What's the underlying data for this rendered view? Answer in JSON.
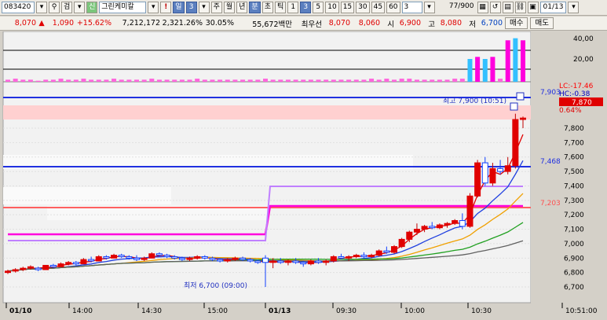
{
  "toolbar": {
    "stock_code": "083420",
    "search_label": "검",
    "stock_name": "그린케미칼",
    "alert_label": "!",
    "period_label": "일",
    "period_value": "3",
    "periods": [
      "주",
      "월",
      "년",
      "분",
      "초",
      "틱"
    ],
    "minute_options": [
      "1",
      "3",
      "5",
      "10",
      "15",
      "30",
      "45",
      "60"
    ],
    "selected_minute": "3",
    "count_value": "3",
    "data_count": "77/900",
    "date": "01/13"
  },
  "quote": {
    "price": "8,070",
    "change": "1,090",
    "change_rate": "+15.62%",
    "volume": "7,212,172",
    "volume_rate": "2,321.26%",
    "turnover": "30.05%",
    "amount": "55,672백만",
    "best_ask_label": "최우선",
    "best_ask": "8,070",
    "best_bid": "8,060",
    "open_label": "시",
    "open": "6,900",
    "high_label": "고",
    "high": "8,080",
    "low_label": "저",
    "low": "6,700",
    "buy_label": "매수",
    "sell_label": "매도"
  },
  "chart_data": {
    "type": "candlestick",
    "price_axis": {
      "min": 6700,
      "max": 7900,
      "ticks": [
        "7,800",
        "7,700",
        "7,600",
        "7,500",
        "7,400",
        "7,300",
        "7,200",
        "7,100",
        "7,000",
        "6,900",
        "6,800",
        "6,700"
      ]
    },
    "volume_axis": {
      "ticks": [
        "40,00",
        "20,00"
      ]
    },
    "time_labels": [
      "01/10",
      "14:00",
      "14:30",
      "15:00",
      "01/13",
      "09:30",
      "10:00",
      "10:30",
      "10:51:00"
    ],
    "right_labels": {
      "lc": "LC:-17.46",
      "hc": "HC:-0.38",
      "current_price": "7,870",
      "current_pct": "0.64%",
      "line_high": "7,903",
      "line_mid": "7,468",
      "line_low": "7,203"
    },
    "annotations": {
      "high": "최고 7,900 (10:51)",
      "low": "최저 6,700 (09:00)"
    },
    "candles": [
      [
        6800,
        6820,
        6790,
        6810
      ],
      [
        6810,
        6830,
        6800,
        6820
      ],
      [
        6820,
        6840,
        6810,
        6830
      ],
      [
        6830,
        6850,
        6820,
        6840
      ],
      [
        6830,
        6840,
        6810,
        6820
      ],
      [
        6820,
        6850,
        6820,
        6850
      ],
      [
        6850,
        6860,
        6830,
        6840
      ],
      [
        6840,
        6870,
        6840,
        6860
      ],
      [
        6860,
        6880,
        6850,
        6870
      ],
      [
        6870,
        6880,
        6850,
        6860
      ],
      [
        6860,
        6900,
        6860,
        6890
      ],
      [
        6890,
        6910,
        6870,
        6880
      ],
      [
        6880,
        6920,
        6880,
        6910
      ],
      [
        6910,
        6920,
        6890,
        6900
      ],
      [
        6900,
        6930,
        6900,
        6920
      ],
      [
        6920,
        6930,
        6900,
        6910
      ],
      [
        6910,
        6920,
        6890,
        6900
      ],
      [
        6900,
        6920,
        6880,
        6890
      ],
      [
        6890,
        6910,
        6880,
        6900
      ],
      [
        6900,
        6940,
        6900,
        6930
      ],
      [
        6930,
        6940,
        6910,
        6920
      ],
      [
        6920,
        6930,
        6900,
        6910
      ],
      [
        6910,
        6920,
        6890,
        6900
      ],
      [
        6900,
        6910,
        6880,
        6890
      ],
      [
        6890,
        6910,
        6880,
        6900
      ],
      [
        6900,
        6920,
        6890,
        6910
      ],
      [
        6910,
        6920,
        6890,
        6900
      ],
      [
        6900,
        6910,
        6880,
        6890
      ],
      [
        6890,
        6900,
        6870,
        6880
      ],
      [
        6880,
        6900,
        6870,
        6890
      ],
      [
        6890,
        6910,
        6880,
        6900
      ],
      [
        6900,
        6910,
        6880,
        6890
      ],
      [
        6890,
        6900,
        6870,
        6880
      ],
      [
        6880,
        6890,
        6860,
        6870
      ],
      [
        6900,
        6920,
        6700,
        6870
      ],
      [
        6870,
        6900,
        6830,
        6880
      ],
      [
        6880,
        6900,
        6860,
        6870
      ],
      [
        6870,
        6890,
        6850,
        6880
      ],
      [
        6880,
        6900,
        6860,
        6870
      ],
      [
        6870,
        6880,
        6840,
        6860
      ],
      [
        6860,
        6890,
        6850,
        6880
      ],
      [
        6880,
        6900,
        6860,
        6870
      ],
      [
        6870,
        6890,
        6850,
        6880
      ],
      [
        6880,
        6920,
        6870,
        6910
      ],
      [
        6910,
        6930,
        6890,
        6900
      ],
      [
        6900,
        6920,
        6880,
        6910
      ],
      [
        6910,
        6930,
        6900,
        6920
      ],
      [
        6920,
        6940,
        6900,
        6910
      ],
      [
        6910,
        6930,
        6900,
        6920
      ],
      [
        6920,
        6960,
        6910,
        6950
      ],
      [
        6950,
        6980,
        6930,
        6940
      ],
      [
        6940,
        6990,
        6930,
        6980
      ],
      [
        6980,
        7040,
        6970,
        7030
      ],
      [
        7030,
        7090,
        7010,
        7080
      ],
      [
        7080,
        7140,
        7060,
        7100
      ],
      [
        7100,
        7130,
        7080,
        7120
      ],
      [
        7120,
        7150,
        7100,
        7110
      ],
      [
        7110,
        7140,
        7100,
        7130
      ],
      [
        7130,
        7150,
        7110,
        7140
      ],
      [
        7140,
        7170,
        7130,
        7160
      ],
      [
        7160,
        7210,
        7100,
        7120
      ],
      [
        7120,
        7350,
        7110,
        7330
      ],
      [
        7330,
        7580,
        7320,
        7560
      ],
      [
        7560,
        7600,
        7400,
        7420
      ],
      [
        7420,
        7560,
        7400,
        7520
      ],
      [
        7520,
        7580,
        7480,
        7500
      ],
      [
        7500,
        7600,
        7480,
        7540
      ],
      [
        7540,
        7900,
        7520,
        7860
      ],
      [
        7860,
        7880,
        7800,
        7870
      ]
    ],
    "volumes": [
      2,
      3,
      2,
      2,
      1,
      2,
      2,
      3,
      2,
      2,
      3,
      2,
      2,
      2,
      3,
      2,
      2,
      2,
      2,
      3,
      2,
      2,
      2,
      2,
      2,
      3,
      2,
      2,
      2,
      2,
      2,
      2,
      2,
      2,
      3,
      2,
      2,
      2,
      2,
      2,
      2,
      2,
      2,
      2,
      2,
      2,
      2,
      2,
      3,
      2,
      3,
      2,
      3,
      3,
      2,
      2,
      2,
      2,
      2,
      3,
      3,
      22,
      24,
      22,
      24,
      3,
      40,
      42,
      40
    ],
    "ma_colors": [
      "#e00000",
      "#2040e0",
      "#f0a000",
      "#20a020",
      "#606060"
    ],
    "reference_lines": {
      "high_line": 7903,
      "mid_line": 7468,
      "low_line": 7203
    },
    "overlay_colors": {
      "magenta": "#ff00dd",
      "lavender": "#c080ff",
      "blue": "#2030e0",
      "pink_zone": "#ffd0d0"
    }
  }
}
